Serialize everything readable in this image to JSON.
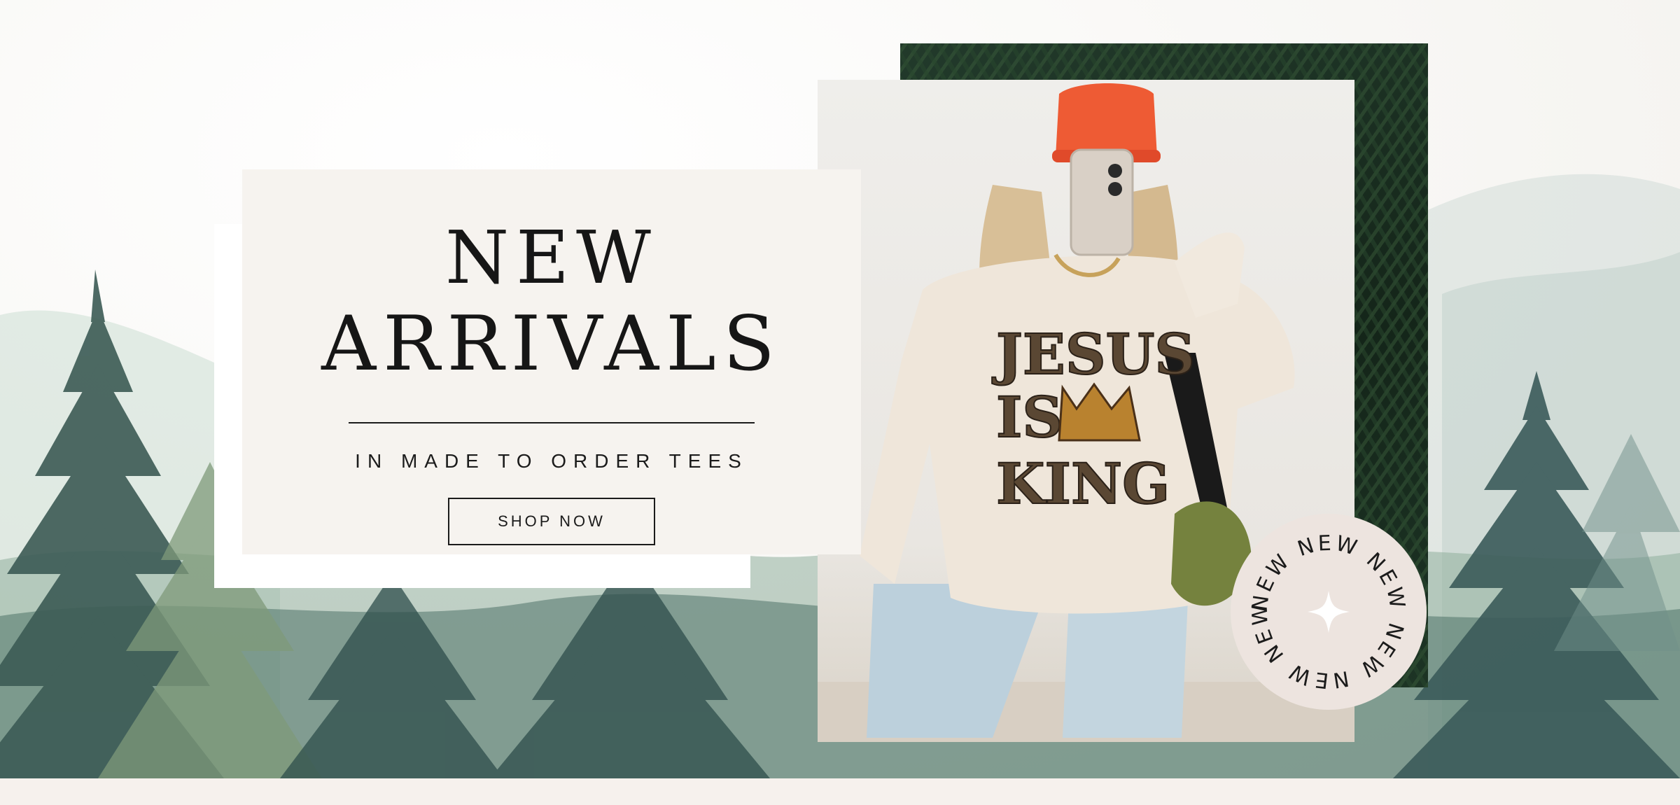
{
  "hero": {
    "title_line1": "NEW",
    "title_line2": "ARRIVALS",
    "subtitle": "IN MADE TO ORDER TEES",
    "cta_label": "SHOP NOW",
    "badge_text": "NEW NEW NEW NEW NEW NEW",
    "photo_print_text": "JESUS IS KING"
  },
  "colors": {
    "card_bg": "#f6f3ef",
    "ink": "#1b1b1b",
    "badge_bg": "#ede4df",
    "forest_dark": "#2f4f4a",
    "forest_light": "#a9c3b2",
    "footer_strip": "#f6f1ed"
  }
}
